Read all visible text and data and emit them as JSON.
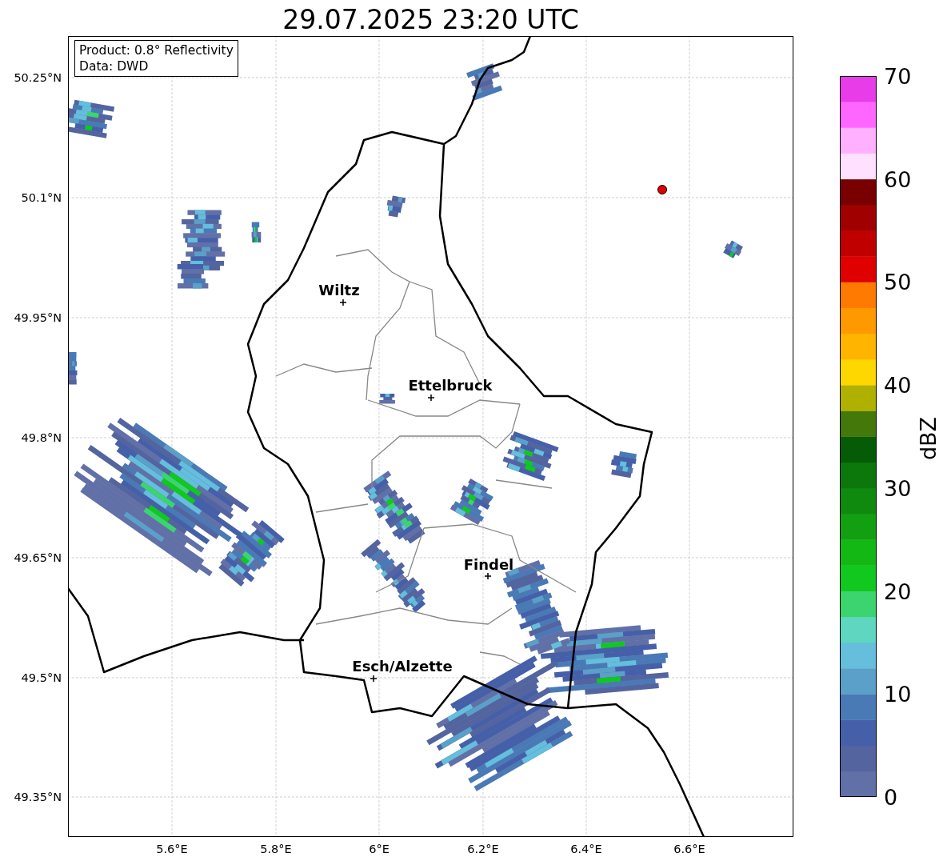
{
  "title": "29.07.2025 23:20 UTC",
  "legend": {
    "lines": [
      "Product: 0.8° Reflectivity",
      "Data: DWD"
    ]
  },
  "map": {
    "cities": [
      {
        "name": "Wiltz"
      },
      {
        "name": "Ettelbruck"
      },
      {
        "name": "Findel"
      },
      {
        "name": "Esch/Alzette"
      }
    ],
    "x_ticks": [
      "5.6°E",
      "5.8°E",
      "6°E",
      "6.2°E",
      "6.4°E",
      "6.6°E"
    ],
    "y_ticks": [
      "50.25°N",
      "50.1°N",
      "49.95°N",
      "49.8°N",
      "49.65°N",
      "49.5°N",
      "49.35°N"
    ]
  },
  "colorbar": {
    "label": "dBZ",
    "ticks": [
      "70",
      "60",
      "50",
      "40",
      "30",
      "20",
      "10",
      "0"
    ],
    "bands": [
      {
        "color": "#6270a8"
      },
      {
        "color": "#54649f"
      },
      {
        "color": "#4560a8"
      },
      {
        "color": "#4a7ab5"
      },
      {
        "color": "#5aa0c8"
      },
      {
        "color": "#64bedc"
      },
      {
        "color": "#5fd6c0"
      },
      {
        "color": "#3cd46e"
      },
      {
        "color": "#10c81e"
      },
      {
        "color": "#14b814"
      },
      {
        "color": "#12a012"
      },
      {
        "color": "#0f8a0f"
      },
      {
        "color": "#0c780c"
      },
      {
        "color": "#065c06"
      },
      {
        "color": "#44780a"
      },
      {
        "color": "#b0b000"
      },
      {
        "color": "#ffd700"
      },
      {
        "color": "#ffb400"
      },
      {
        "color": "#ff9900"
      },
      {
        "color": "#ff7a00"
      },
      {
        "color": "#e00000"
      },
      {
        "color": "#c00000"
      },
      {
        "color": "#a00000"
      },
      {
        "color": "#780000"
      },
      {
        "color": "#ffe0ff"
      },
      {
        "color": "#ffb0ff"
      },
      {
        "color": "#ff66ff"
      },
      {
        "color": "#e83ce8"
      }
    ]
  }
}
